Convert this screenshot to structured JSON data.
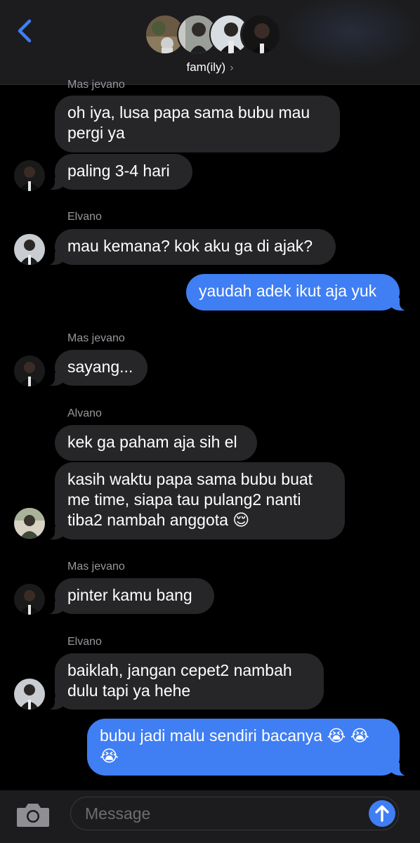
{
  "header": {
    "group_name": "fam(ily)",
    "chevron": "›",
    "icons": {
      "back": "chevron-left-icon",
      "detail": "chevron-right-icon"
    }
  },
  "messages": [
    {
      "sender": "Mas jevano",
      "text": "oh iya, lusa papa sama bubu mau pergi ya",
      "line1": "oh iya, lusa papa sama bubu mau",
      "line2": "pergi ya",
      "direction": "incoming"
    },
    {
      "text": "paling 3-4 hari",
      "direction": "incoming"
    },
    {
      "sender": "Elvano",
      "text": "mau kemana? kok aku ga di ajak?",
      "direction": "incoming"
    },
    {
      "text": "yaudah adek ikut aja yuk",
      "direction": "outgoing"
    },
    {
      "sender": "Mas jevano",
      "text": "sayang...",
      "direction": "incoming"
    },
    {
      "sender": "Alvano",
      "text": "kek ga paham aja sih el",
      "direction": "incoming"
    },
    {
      "line1": "kasih waktu papa sama bubu buat",
      "line2": "me time, siapa tau pulang2 nanti",
      "line3": "tiba2 nambah anggota 😌",
      "direction": "incoming"
    },
    {
      "sender": "Mas jevano",
      "text": "pinter kamu bang",
      "direction": "incoming"
    },
    {
      "sender": "Elvano",
      "line1": "baiklah, jangan cepet2 nambah",
      "line2": "dulu tapi ya hehe",
      "direction": "incoming"
    },
    {
      "line1": "bubu jadi malu sendiri bacanya 😭 😭",
      "line2": "😭",
      "direction": "outgoing"
    }
  ],
  "input": {
    "placeholder": "Message",
    "icons": {
      "camera": "camera-icon",
      "send": "send-arrow-icon"
    }
  },
  "colors": {
    "background": "#000000",
    "incoming_bubble": "#262628",
    "outgoing_bubble": "#3f7ef3",
    "accent": "#3f7ef3",
    "sender_label": "#98989d"
  }
}
